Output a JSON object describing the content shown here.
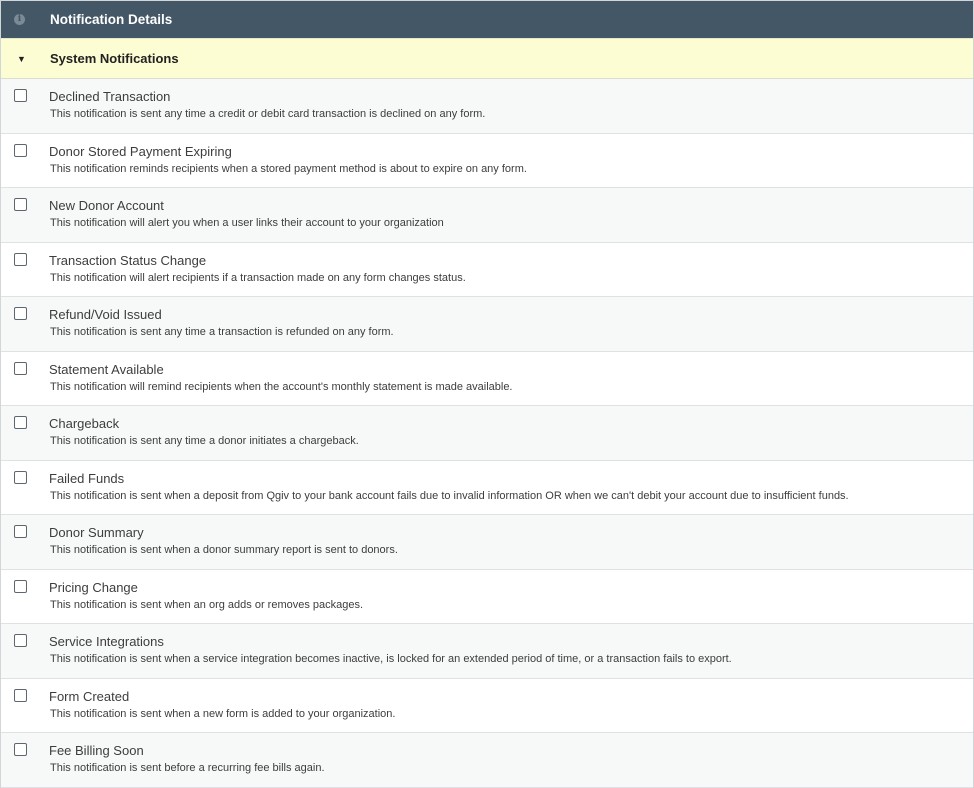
{
  "header": {
    "title": "Notification Details",
    "icon": "info-icon"
  },
  "section": {
    "title": "System Notifications",
    "caret": "▼"
  },
  "notifications": [
    {
      "title": "Declined Transaction",
      "description": "This notification is sent any time a credit or debit card transaction is declined on any form.",
      "checked": false
    },
    {
      "title": "Donor Stored Payment Expiring",
      "description": "This notification reminds recipients when a stored payment method is about to expire on any form.",
      "checked": false
    },
    {
      "title": "New Donor Account",
      "description": "This notification will alert you when a user links their account to your organization",
      "checked": false
    },
    {
      "title": "Transaction Status Change",
      "description": "This notification will alert recipients if a transaction made on any form changes status.",
      "checked": false
    },
    {
      "title": "Refund/Void Issued",
      "description": "This notification is sent any time a transaction is refunded on any form.",
      "checked": false
    },
    {
      "title": "Statement Available",
      "description": "This notification will remind recipients when the account's monthly statement is made available.",
      "checked": false
    },
    {
      "title": "Chargeback",
      "description": "This notification is sent any time a donor initiates a chargeback.",
      "checked": false
    },
    {
      "title": "Failed Funds",
      "description": "This notification is sent when a deposit from Qgiv to your bank account fails due to invalid information OR when we can't debit your account due to insufficient funds.",
      "checked": false
    },
    {
      "title": "Donor Summary",
      "description": "This notification is sent when a donor summary report is sent to donors.",
      "checked": false
    },
    {
      "title": "Pricing Change",
      "description": "This notification is sent when an org adds or removes packages.",
      "checked": false
    },
    {
      "title": "Service Integrations",
      "description": "This notification is sent when a service integration becomes inactive, is locked for an extended period of time, or a transaction fails to export.",
      "checked": false
    },
    {
      "title": "Form Created",
      "description": "This notification is sent when a new form is added to your organization.",
      "checked": false
    },
    {
      "title": "Fee Billing Soon",
      "description": "This notification is sent before a recurring fee bills again.",
      "checked": false
    }
  ]
}
